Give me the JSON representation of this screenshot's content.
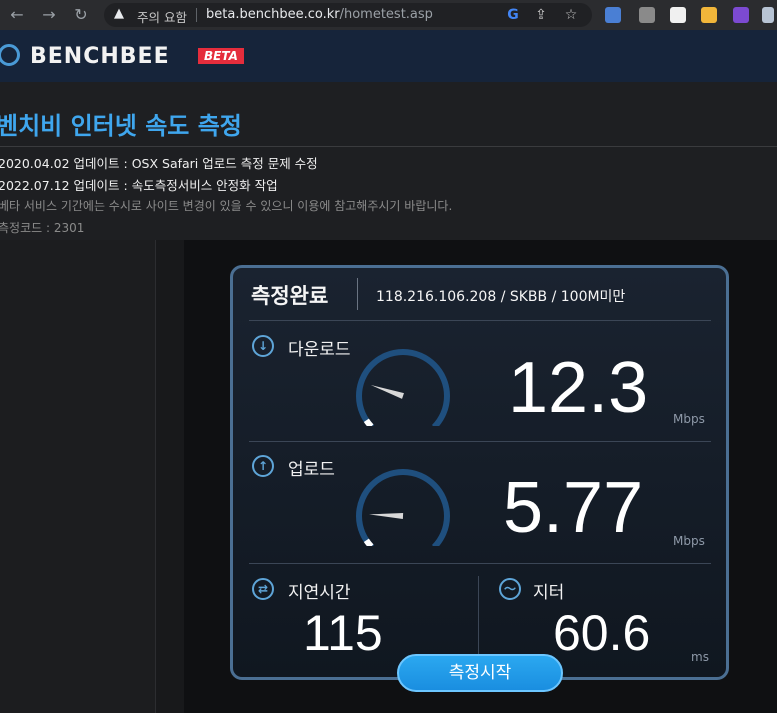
{
  "browser": {
    "back_icon": "arrow-left-icon",
    "forward_icon": "arrow-right-icon",
    "reload_icon": "reload-icon",
    "warning_text": "주의 요함",
    "url_host": "beta.benchbee.co.kr",
    "url_path": "/hometest.asp"
  },
  "header": {
    "logo_text": "BENCHBEE",
    "beta_label": "BETA"
  },
  "page": {
    "title": "벤치비 인터넷 속도 측정",
    "notices": [
      "2020.04.02 업데이트 : OSX Safari 업로드 측정 문제 수정",
      "2022.07.12 업데이트 : 속도측정서비스 안정화 작업",
      "베타 서비스 기간에는 수시로 사이트 변경이 있을 수 있으니 이용에 참고해주시기 바랍니다.",
      "측정코드 : 2301"
    ]
  },
  "result": {
    "status": "측정완료",
    "ip_info": "118.216.106.208 / SKBB / 100M미만",
    "download": {
      "label": "다운로드",
      "value": "12.3",
      "unit": "Mbps",
      "gauge_fraction": 0.12
    },
    "upload": {
      "label": "업로드",
      "value": "5.77",
      "unit": "Mbps",
      "gauge_fraction": 0.06
    },
    "latency": {
      "label": "지연시간",
      "value": "115",
      "unit": "ms"
    },
    "jitter": {
      "label": "지터",
      "value": "60.6",
      "unit": "ms"
    },
    "start_button": "측정시작"
  },
  "colors": {
    "accent": "#3fa6ee",
    "gauge_arc": "#1f4f7e",
    "button": "#1a8ee0"
  }
}
